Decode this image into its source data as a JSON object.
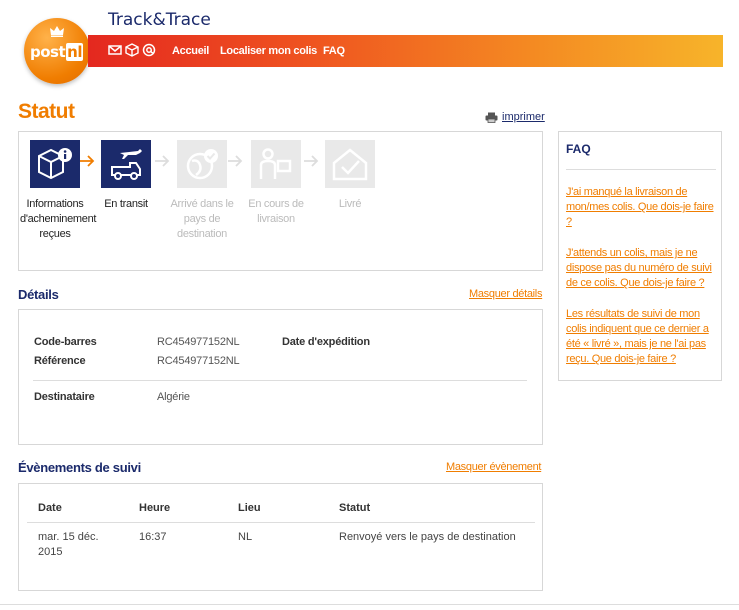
{
  "header": {
    "logo_text_post": "post",
    "logo_text_nl": "nl",
    "app_title": "Track&Trace",
    "nav": [
      "Accueil",
      "Localiser mon colis",
      "FAQ"
    ]
  },
  "status": {
    "title": "Statut",
    "print_label": "imprimer",
    "steps": [
      {
        "label": "Informations d'acheminement reçues",
        "state": "active",
        "icon": "package-info-icon"
      },
      {
        "label": "En transit",
        "state": "active",
        "icon": "plane-truck-icon"
      },
      {
        "label": "Arrivé dans le pays de destination",
        "state": "inactive",
        "icon": "globe-check-icon"
      },
      {
        "label": "En cours de livraison",
        "state": "inactive",
        "icon": "delivery-person-icon"
      },
      {
        "label": "Livré",
        "state": "inactive",
        "icon": "house-check-icon"
      }
    ]
  },
  "details": {
    "title": "Détails",
    "toggle_label": "Masquer détails",
    "barcode_label": "Code-barres",
    "barcode_value": "RC454977152NL",
    "ship_date_label": "Date d'expédition",
    "reference_label": "Référence",
    "reference_value": "RC454977152NL",
    "recipient_label": "Destinataire",
    "recipient_value": "Algérie"
  },
  "events": {
    "title": "Évènements de suivi",
    "toggle_label": "Masquer évènement",
    "columns": [
      "Date",
      "Heure",
      "Lieu",
      "Statut"
    ],
    "rows": [
      {
        "date": "mar. 15 déc. 2015",
        "time": "16:37",
        "place": "NL",
        "status": "Renvoyé vers le pays de destination"
      }
    ]
  },
  "faq": {
    "title": "FAQ",
    "items": [
      "J'ai manqué la livraison de mon/mes colis. Que dois-je faire ?",
      "J'attends un colis, mais je ne dispose pas du numéro de suivi de ce colis. Que dois-je faire ?",
      "Les résultats de suivi de mon colis indiquent que ce dernier a été « livré », mais je ne l'ai pas reçu. Que dois-je faire ?"
    ]
  },
  "colors": {
    "brand_orange": "#f07d00",
    "brand_navy": "#1b2a6b",
    "inactive_step": "#e9e9e9"
  }
}
